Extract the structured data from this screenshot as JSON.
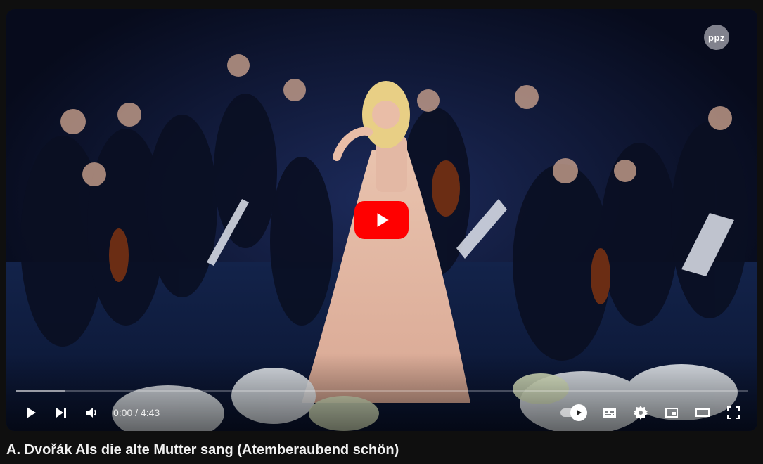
{
  "video": {
    "title": "A. Dvořák Als die alte Mutter sang (Atemberaubend schön)",
    "watermark": "ppz",
    "current_time": "0:00",
    "separator": " / ",
    "duration": "4:43",
    "played_fraction": 0.0,
    "buffered_fraction": 0.066
  },
  "icons": {
    "big_play": "play-icon",
    "play": "play-icon",
    "next": "skip-next-icon",
    "volume": "volume-icon",
    "autoplay": "autoplay-toggle-icon",
    "subtitles": "subtitles-icon",
    "settings": "gear-icon",
    "miniplayer": "miniplayer-icon",
    "theater": "theater-mode-icon",
    "fullscreen": "fullscreen-icon"
  },
  "colors": {
    "accent": "#ff0000",
    "background": "#0f0f0f",
    "title_text": "#f1f1f1"
  }
}
